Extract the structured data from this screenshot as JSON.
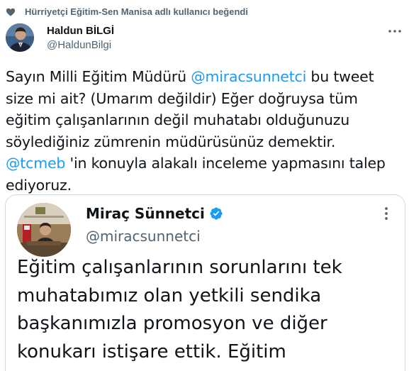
{
  "social_context": {
    "text": "Hürriyetçi Eğitim-Sen Manisa adlı kullanıcı beğendi",
    "icon": "heart-icon"
  },
  "author": {
    "name": "Haldun BİLGİ",
    "handle": "@HaldunBilgi"
  },
  "tweet": {
    "line1_pre": "Sayın Milli Eğitim Müdürü ",
    "line1_mention": "@miracsunnetci",
    "line1_post": " bu tweet",
    "line2": "size mi ait? (Umarım değildir) Eğer doğruysa tüm",
    "line3": "eğitim çalışanlarının değil muhatabı olduğunuzu",
    "line4": "söylediğiniz zümrenin müdürüsünüz demektir.",
    "line5_mention": "@tcmeb",
    "line5_post": " 'in konuyla alakalı inceleme yapmasını talep",
    "line6": "ediyoruz."
  },
  "quoted": {
    "name": "Miraç Sünnetci",
    "handle": "@miracsunnetci",
    "verified": true,
    "lines": [
      "Eğitim çalışanlarının sorunlarını tek",
      "muhatabımız olan yetkili sendika",
      "başkanımızla promosyon ve diğer",
      "konukarı istişare ettik. Eğitim"
    ]
  },
  "colors": {
    "accent": "#1d9bf0",
    "secondary_text": "#536471",
    "primary_text": "#0f1419",
    "border": "#cfd9de"
  }
}
